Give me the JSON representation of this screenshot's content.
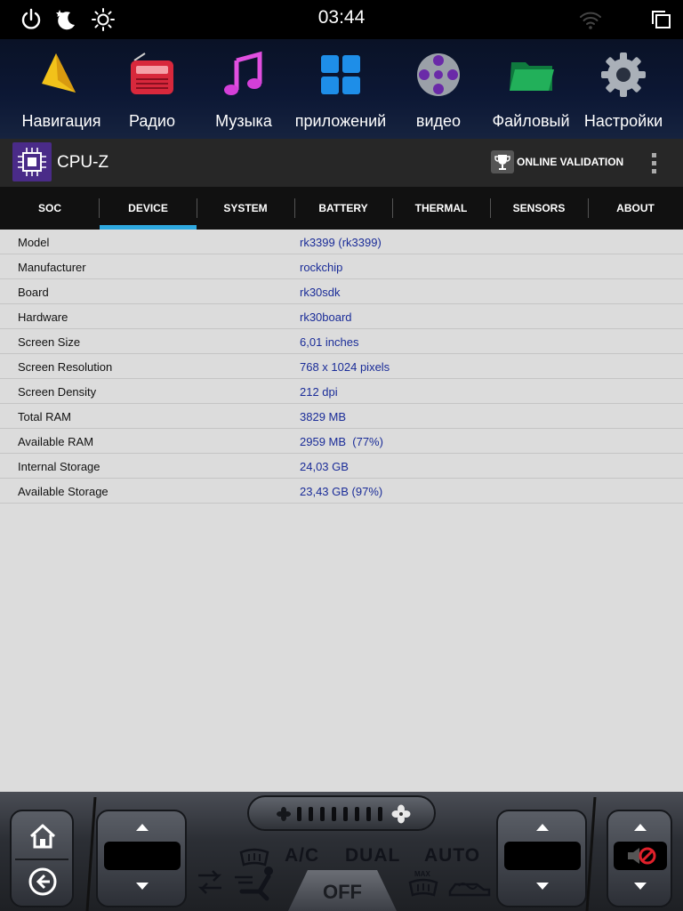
{
  "status_bar": {
    "time": "03:44",
    "icons": [
      "power-icon",
      "night-mode-icon",
      "brightness-icon",
      "wifi-icon",
      "recent-apps-icon"
    ]
  },
  "launcher": {
    "apps": [
      {
        "label": "Навигация",
        "icon": "navigation-icon"
      },
      {
        "label": "Радио",
        "icon": "radio-icon"
      },
      {
        "label": "Музыка",
        "icon": "music-icon"
      },
      {
        "label": "приложений",
        "icon": "apps-grid-icon"
      },
      {
        "label": "видео",
        "icon": "video-reel-icon"
      },
      {
        "label": "Файловый",
        "icon": "folder-icon"
      },
      {
        "label": "Настройки",
        "icon": "settings-gear-icon"
      }
    ]
  },
  "app_bar": {
    "title": "CPU-Z",
    "validation_label": "ONLINE VALIDATION"
  },
  "tabs": [
    {
      "label": "SOC",
      "active": false
    },
    {
      "label": "DEVICE",
      "active": true
    },
    {
      "label": "SYSTEM",
      "active": false
    },
    {
      "label": "BATTERY",
      "active": false
    },
    {
      "label": "THERMAL",
      "active": false
    },
    {
      "label": "SENSORS",
      "active": false
    },
    {
      "label": "ABOUT",
      "active": false
    }
  ],
  "device_info": [
    {
      "key": "Model",
      "value": "rk3399 (rk3399)"
    },
    {
      "key": "Manufacturer",
      "value": "rockchip"
    },
    {
      "key": "Board",
      "value": "rk30sdk"
    },
    {
      "key": "Hardware",
      "value": "rk30board"
    },
    {
      "key": "Screen Size",
      "value": "6,01 inches"
    },
    {
      "key": "Screen Resolution",
      "value": "768 x 1024 pixels"
    },
    {
      "key": "Screen Density",
      "value": "212 dpi"
    },
    {
      "key": "Total RAM",
      "value": "3829 MB"
    },
    {
      "key": "Available RAM",
      "value": "2959 MB  (77%)"
    },
    {
      "key": "Internal Storage",
      "value": "24,03 GB"
    },
    {
      "key": "Available Storage",
      "value": "23,43 GB (97%)"
    }
  ],
  "climate": {
    "ac_label": "A/C",
    "dual_label": "DUAL",
    "auto_label": "AUTO",
    "off_label": "OFF",
    "max_label": "MAX"
  },
  "colors": {
    "tab_indicator": "#2ea8df",
    "value_text": "#1a2c98",
    "content_bg": "#dcdcdc"
  }
}
